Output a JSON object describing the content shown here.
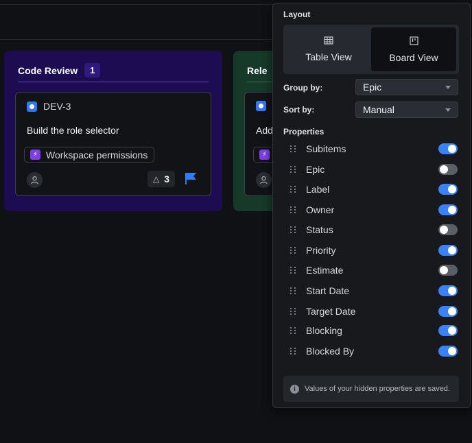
{
  "board": {
    "columns": [
      {
        "title": "Code Review",
        "count": "1",
        "card": {
          "id": "DEV-3",
          "title": "Build the role selector",
          "epic": "Workspace permissions",
          "subitems_count": "3"
        }
      },
      {
        "title": "Rele",
        "card": {
          "title": "Add"
        }
      }
    ]
  },
  "panel": {
    "layout_title": "Layout",
    "views": [
      {
        "label": "Table View",
        "icon": "table-icon",
        "selected": false
      },
      {
        "label": "Board View",
        "icon": "board-icon",
        "selected": true
      }
    ],
    "group_by": {
      "label": "Group by:",
      "value": "Epic"
    },
    "sort_by": {
      "label": "Sort by:",
      "value": "Manual"
    },
    "properties_title": "Properties",
    "properties": [
      {
        "name": "Subitems",
        "enabled": true
      },
      {
        "name": "Epic",
        "enabled": false
      },
      {
        "name": "Label",
        "enabled": true
      },
      {
        "name": "Owner",
        "enabled": true
      },
      {
        "name": "Status",
        "enabled": false
      },
      {
        "name": "Priority",
        "enabled": true
      },
      {
        "name": "Estimate",
        "enabled": false
      },
      {
        "name": "Start Date",
        "enabled": true
      },
      {
        "name": "Target Date",
        "enabled": true
      },
      {
        "name": "Blocking",
        "enabled": true
      },
      {
        "name": "Blocked By",
        "enabled": true
      }
    ],
    "info": "Values of your hidden properties are saved."
  },
  "colors": {
    "accent": "#3b82f6",
    "review_column": "#1e0c52",
    "release_column": "#16392a",
    "epic_icon": "#7b3fe4"
  }
}
